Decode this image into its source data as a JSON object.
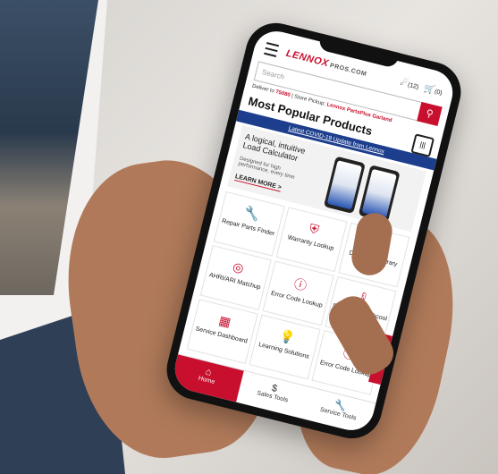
{
  "header": {
    "brand": "LENNOX",
    "brand_sub": "PROS.COM",
    "notifications": "(12)",
    "cart": "(0)"
  },
  "search": {
    "placeholder": "Search"
  },
  "deliver": {
    "prefix": "Deliver to",
    "zip": "75080",
    "middle": "| Store Pickup:",
    "store": "Lennox PartsPlus Garland"
  },
  "section_title": "Most Popular Products",
  "covid_link": "Latest COVID-19 Update from Lennox",
  "banner": {
    "title": "A logical, intuitive Load Calculator",
    "subtitle": "Designed for high performance, every time",
    "cta": "LEARN MORE >"
  },
  "tiles": [
    {
      "label": "Repair Parts Finder",
      "icon": "wrench-icon"
    },
    {
      "label": "Warranty Lookup",
      "icon": "shield-icon"
    },
    {
      "label": "Document Library",
      "icon": "document-icon"
    },
    {
      "label": "AHRI/ARI Matchup",
      "icon": "target-icon"
    },
    {
      "label": "Error Code Lookup",
      "icon": "alert-icon"
    },
    {
      "label": "SuperHeat/ Subcool",
      "icon": "thermometer-icon"
    },
    {
      "label": "Service Dashboard",
      "icon": "dashboard-icon"
    },
    {
      "label": "Learning Solutions",
      "icon": "lightbulb-icon"
    },
    {
      "label": "Error Code Lookup",
      "icon": "alert-icon"
    }
  ],
  "feedback": "Feedback",
  "tabs": [
    {
      "label": "Home",
      "icon": "home-icon",
      "active": true
    },
    {
      "label": "Sales Tools",
      "icon": "dollar-icon",
      "active": false
    },
    {
      "label": "Service Tools",
      "icon": "tools-icon",
      "active": false
    }
  ],
  "colors": {
    "brand_red": "#c8102e",
    "covid_blue": "#1d3e8c"
  }
}
